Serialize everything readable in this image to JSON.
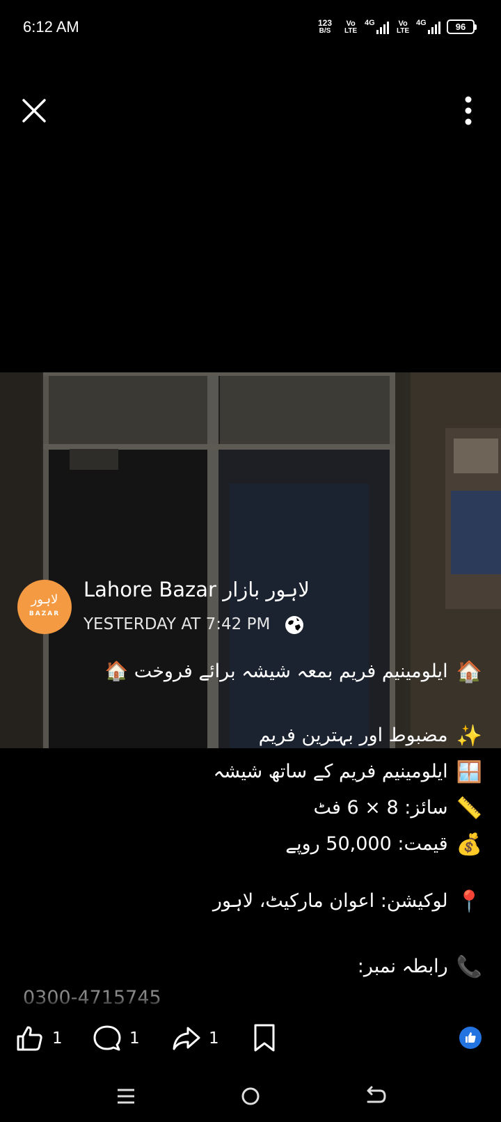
{
  "status_bar": {
    "time": "6:12 AM",
    "net_speed_value": "123",
    "net_speed_unit": "B/S",
    "volte1_top": "Vo",
    "volte1_bottom": "LTE",
    "network1": "4G",
    "volte2_top": "Vo",
    "volte2_bottom": "LTE",
    "network2": "4G",
    "battery": "96"
  },
  "post": {
    "page_name": "Lahore Bazar لاہور بازار",
    "timestamp": "YESTERDAY AT 7:42 PM",
    "avatar_brand": "BAZAR",
    "avatar_urdu": "لاہور",
    "lines": [
      {
        "emoji": "🏠",
        "text": "ایلومینیم فریم بمعہ شیشہ برائے فروخت 🏠"
      },
      {
        "emoji": "✨",
        "text": "مضبوط اور بہترین فریم"
      },
      {
        "emoji": "🪟",
        "text": "ایلومینیم فریم کے ساتھ شیشہ"
      },
      {
        "emoji": "📏",
        "text": "سائز: 8 × 6 فٹ"
      },
      {
        "emoji": "💰",
        "text": "قیمت: 50,000 روپے"
      },
      {
        "emoji": "📍",
        "text": "لوکیشن: اعوان مارکیٹ، لاہور"
      },
      {
        "emoji": "📞",
        "text": "رابطہ نمبر:"
      }
    ],
    "phone": "0300-4715745"
  },
  "reactions": {
    "like_count": "1",
    "comment_count": "1",
    "share_count": "1"
  },
  "colors": {
    "background": "#000000",
    "avatar": "#f49a43",
    "like_badge": "#2374e1"
  }
}
